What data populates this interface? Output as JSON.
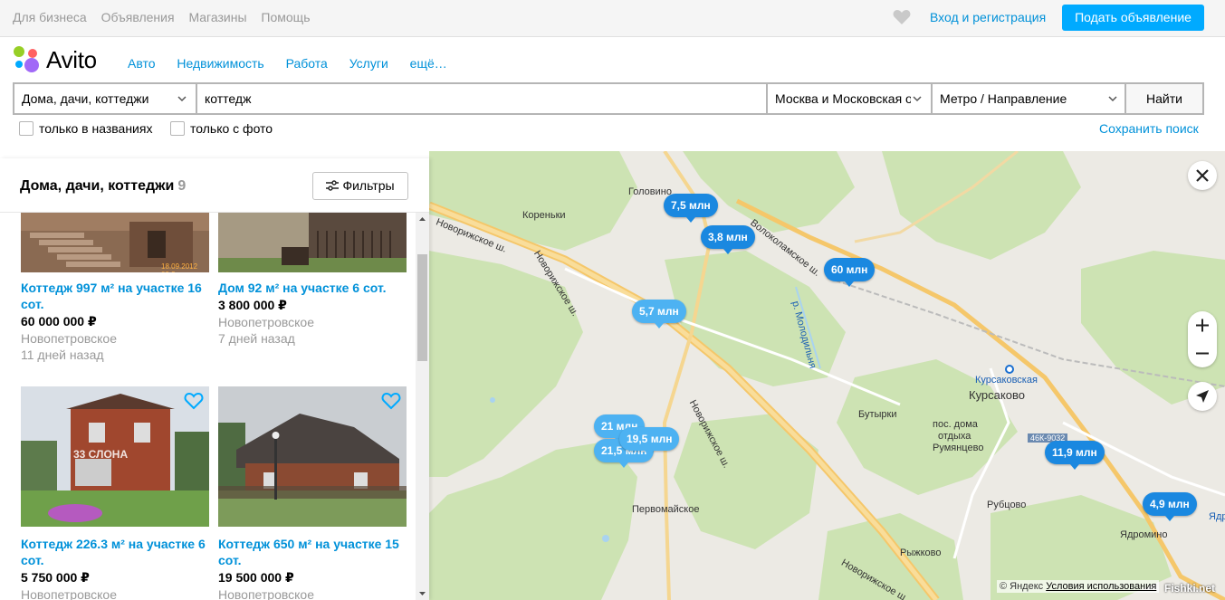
{
  "topbar": {
    "links": [
      "Для бизнеса",
      "Объявления",
      "Магазины",
      "Помощь"
    ],
    "login": "Вход и регистрация",
    "post_button": "Подать объявление"
  },
  "header": {
    "logo_text": "Avito",
    "nav": [
      "Авто",
      "Недвижимость",
      "Работа",
      "Услуги",
      "ещё…"
    ]
  },
  "search": {
    "category": "Дома, дачи, коттеджи",
    "query": "коттедж",
    "region": "Москва и Московская об",
    "metro": "Метро / Направление",
    "submit": "Найти",
    "only_titles": "только в названиях",
    "only_photo": "только с фото",
    "save": "Сохранить поиск"
  },
  "panel": {
    "title": "Дома, дачи, коттеджи",
    "count": "9",
    "filters": "Фильтры"
  },
  "listings": [
    {
      "title": "Коттедж 997 м² на участке 16 сот.",
      "price": "60 000 000 ₽",
      "location": "Новопетровское",
      "date": "11 дней назад"
    },
    {
      "title": "Дом 92 м² на участке 6 сот.",
      "price": "3 800 000 ₽",
      "location": "Новопетровское",
      "date": "7 дней назад"
    },
    {
      "title": "Коттедж 226.3 м² на участке 6 сот.",
      "price": "5 750 000 ₽",
      "location": "Новопетровское",
      "watermark": "33 СЛОНА"
    },
    {
      "title": "Коттедж 650 м² на участке 15 сот.",
      "price": "19 500 000 ₽",
      "location": "Новопетровское"
    }
  ],
  "photo_stamp": "18.09.2012 09:2",
  "map": {
    "pins": [
      "7,5 млн",
      "3,8 млн",
      "60 млн",
      "5,7 млн",
      "21 млн",
      "21,5 млн",
      "19,5 млн",
      "11,9 млн",
      "4,9 млн"
    ],
    "places": {
      "golovino": "Головино",
      "korenki": "Кореньки",
      "kursakovskaya": "Курсаковская",
      "kursakovo": "Курсаково",
      "butyrki": "Бутырки",
      "pos1": "пос. дома",
      "pos2": "отдыха",
      "pos3": "Румянцево",
      "rubtsovo": "Рубцово",
      "pervomayskoe": "Первомайское",
      "ryzhkovo": "Рыжково",
      "yadromino": "Ядромино",
      "yad": "Ядр",
      "river": "р. Молодильня",
      "road_badge": "46К-9032"
    },
    "roads": {
      "nov1": "Новорижское ш.",
      "nov2": "Новорижское ш.",
      "nov3": "Новорижское ш.",
      "nov4": "Новорижское ш.",
      "volok": "Волоколамское ш."
    },
    "copyright": "© Яндекс",
    "terms": "Условия использования",
    "watermark": "Fishki.net"
  },
  "colors": {
    "accent": "#00aaff",
    "link": "#0091d9",
    "pin": "#1a88e0"
  }
}
